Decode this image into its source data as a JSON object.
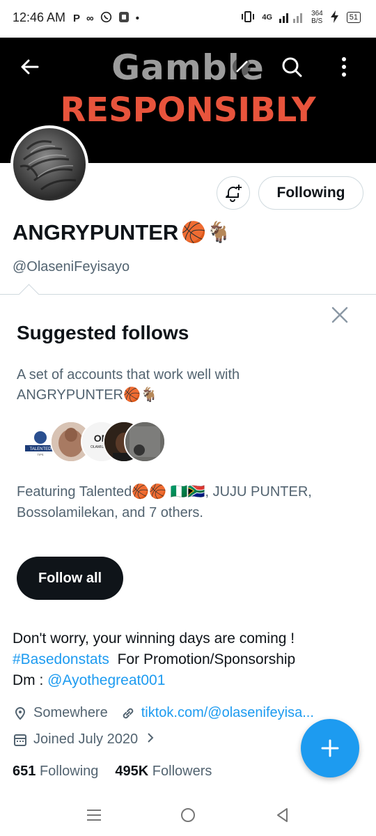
{
  "status_bar": {
    "time": "12:46 AM",
    "left_icons": [
      "p-icon",
      "infinity-icon",
      "whatsapp-icon",
      "app-icon",
      "dot-icon"
    ],
    "network": "4G",
    "speed_value": "364",
    "speed_unit": "B/S",
    "battery": "51"
  },
  "banner": {
    "line1": "Gamble",
    "line2": "RESPONSIBLY"
  },
  "profile": {
    "display_name": "ANGRYPUNTER",
    "display_emojis": "🏀🐐",
    "handle": "@OlaseniFeyisayo",
    "following_button": "Following"
  },
  "suggested": {
    "title": "Suggested follows",
    "description_prefix": "A set of accounts that work well with",
    "description_name": "ANGRYPUNTER",
    "description_emojis": "🏀🐐",
    "face_labels": [
      "TALENTED TIPS",
      "",
      "OM OLAMILEKAN",
      "",
      ""
    ],
    "featuring_prefix": "Featuring Talented",
    "featuring_emojis": "🏀🏀 🇳🇬🇿🇦",
    "featuring_suffix": ", JUJU PUNTER,",
    "featuring_line2": "Bossolamilekan, and 7 others.",
    "follow_all": "Follow all"
  },
  "bio": {
    "line1": "Don't worry, your winning days are coming !",
    "hashtag": "#Basedonstats",
    "line2_rest": "  For Promotion/Sponsorship",
    "line3_prefix": "Dm : ",
    "mention": "@Ayothegreat001"
  },
  "meta": {
    "location": "Somewhere",
    "website": "tiktok.com/@olasenifeyisa...",
    "joined": "Joined July 2020"
  },
  "counts": {
    "following_num": "651",
    "following_label": "Following",
    "followers_num": "495K",
    "followers_label": "Followers"
  },
  "colors": {
    "accent": "#1d9bf0",
    "text": "#0f1419",
    "secondary": "#536471",
    "banner_red": "#e8543c"
  }
}
